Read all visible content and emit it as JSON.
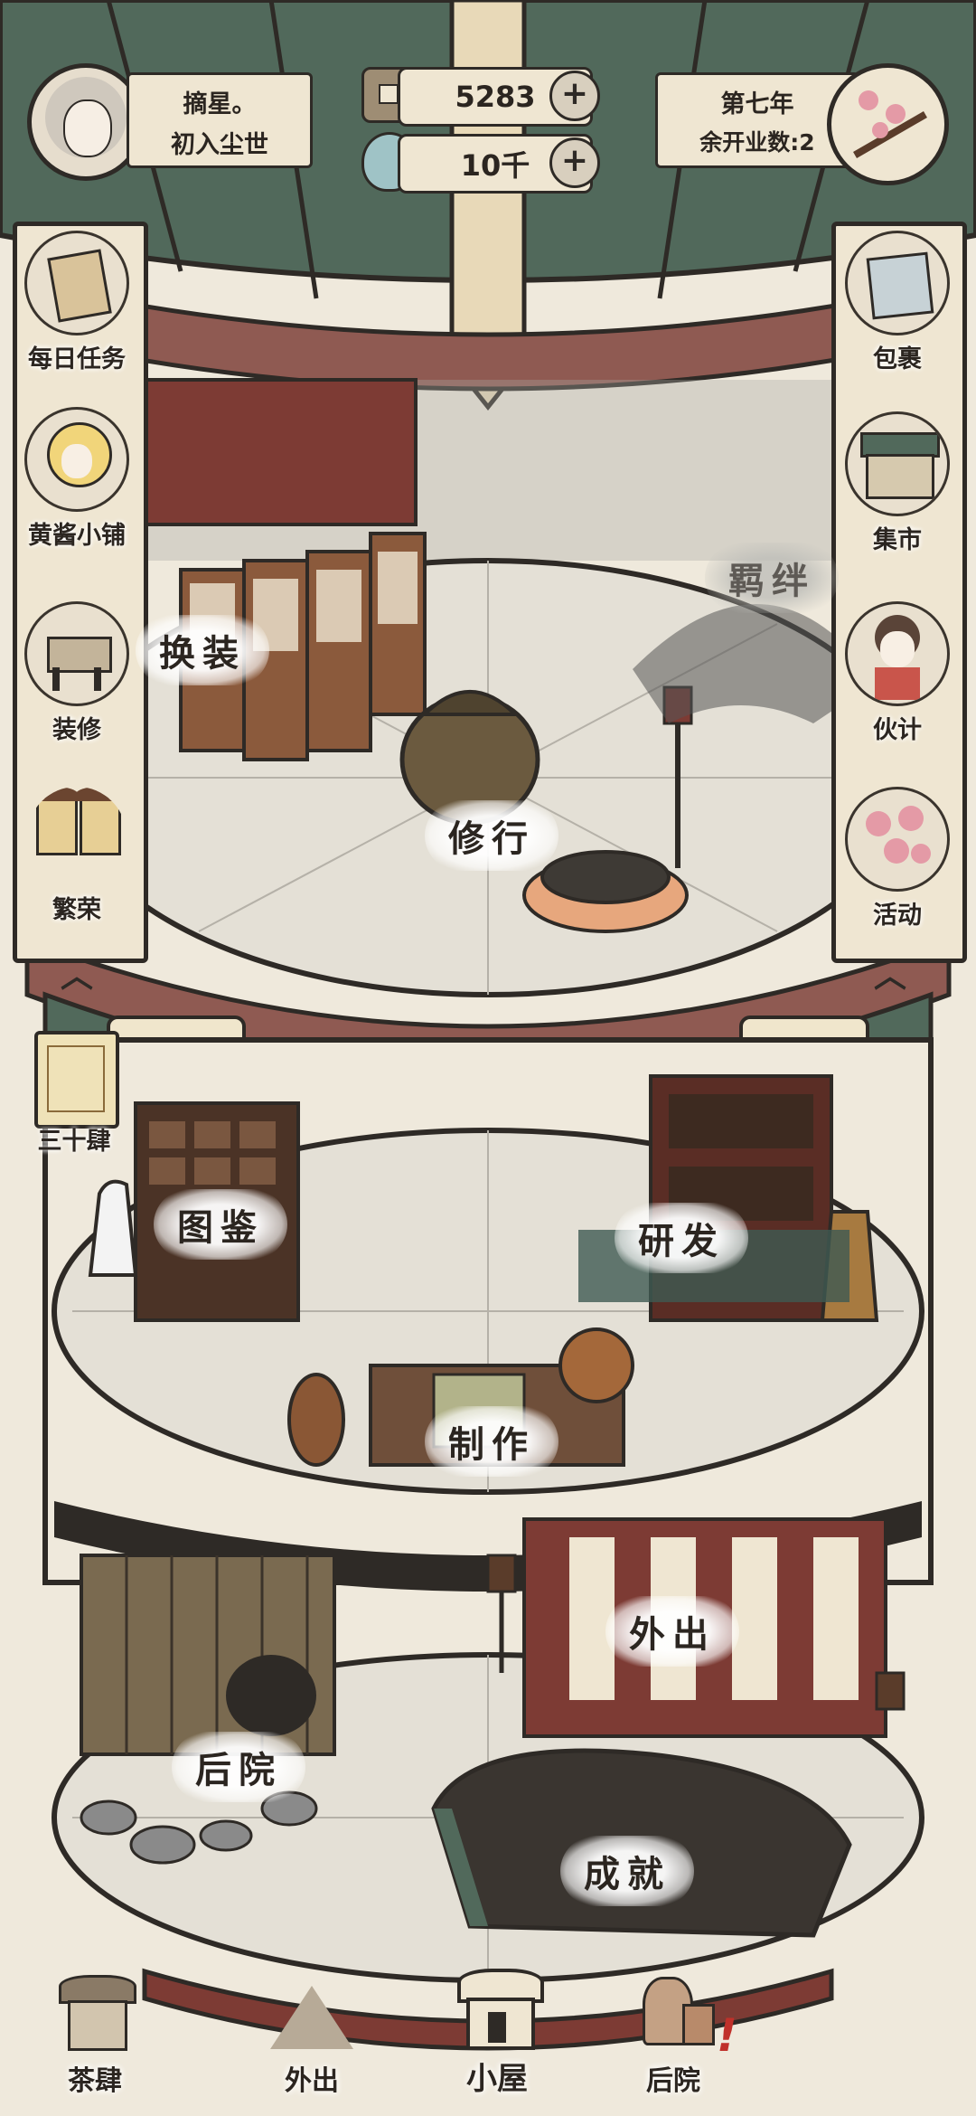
{
  "player": {
    "name": "摘星。",
    "title": "初入尘世"
  },
  "currency": {
    "coins": "5283",
    "gems": "10千"
  },
  "calendar": {
    "year": "第七年",
    "remaining": "余开业数:2"
  },
  "left_menu": [
    {
      "label": "每日任务",
      "icon": "scroll-icon"
    },
    {
      "label": "黄酱小铺",
      "icon": "girl-shop-icon"
    },
    {
      "label": "装修",
      "icon": "table-icon"
    },
    {
      "label": "繁荣",
      "icon": "lantern-icon"
    }
  ],
  "right_menu": [
    {
      "label": "包裹",
      "icon": "bag-icon"
    },
    {
      "label": "集市",
      "icon": "market-icon"
    },
    {
      "label": "伙计",
      "icon": "helper-icon"
    },
    {
      "label": "活动",
      "icon": "blossom-icon"
    }
  ],
  "top_floor": {
    "dress": "换装",
    "practice": "修行",
    "bond": "羁绊"
  },
  "mid_floor": {
    "catalog": "图鉴",
    "research": "研发",
    "craft": "制作"
  },
  "bottom_floor": {
    "backyard": "后院",
    "outing": "外出",
    "achievement": "成就"
  },
  "scroll_badge": "三十肆",
  "nav": [
    {
      "label": "茶肆",
      "icon": "teahouse-icon"
    },
    {
      "label": "外出",
      "icon": "mountain-icon"
    },
    {
      "label": "小屋",
      "icon": "house-icon"
    },
    {
      "label": "后院",
      "icon": "garden-icon"
    }
  ],
  "nav_alert": "!",
  "colors": {
    "roof_green": "#51695b",
    "wood_red": "#7d4a44",
    "paper": "#efe6d2",
    "ink": "#2e2a26",
    "floor": "#e4e0d6"
  }
}
